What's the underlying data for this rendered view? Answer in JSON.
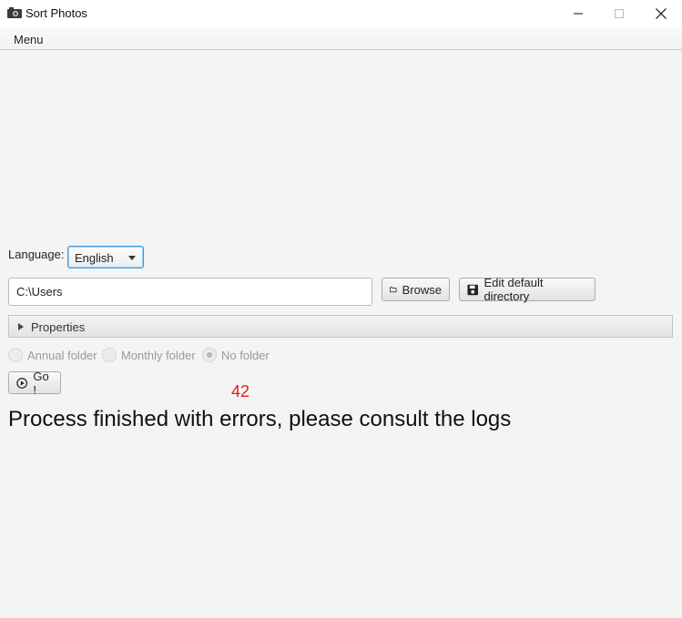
{
  "window": {
    "title": "Sort Photos",
    "icon": "camera-icon"
  },
  "menubar": {
    "menu_label": "Menu"
  },
  "form": {
    "language_label": "Language:",
    "language_value": "English",
    "path_value": "C:\\Users",
    "browse_label": "Browse",
    "edit_default_label": "Edit default directory",
    "properties_label": "Properties",
    "radio_annual": "Annual folder",
    "radio_monthly": "Monthly folder",
    "radio_none": "No folder",
    "go_label": "Go !"
  },
  "result": {
    "count": "42",
    "message": "Process finished with errors, please consult the logs"
  },
  "colors": {
    "count_color": "#e0201c",
    "focus_border": "#3e9ad9"
  }
}
